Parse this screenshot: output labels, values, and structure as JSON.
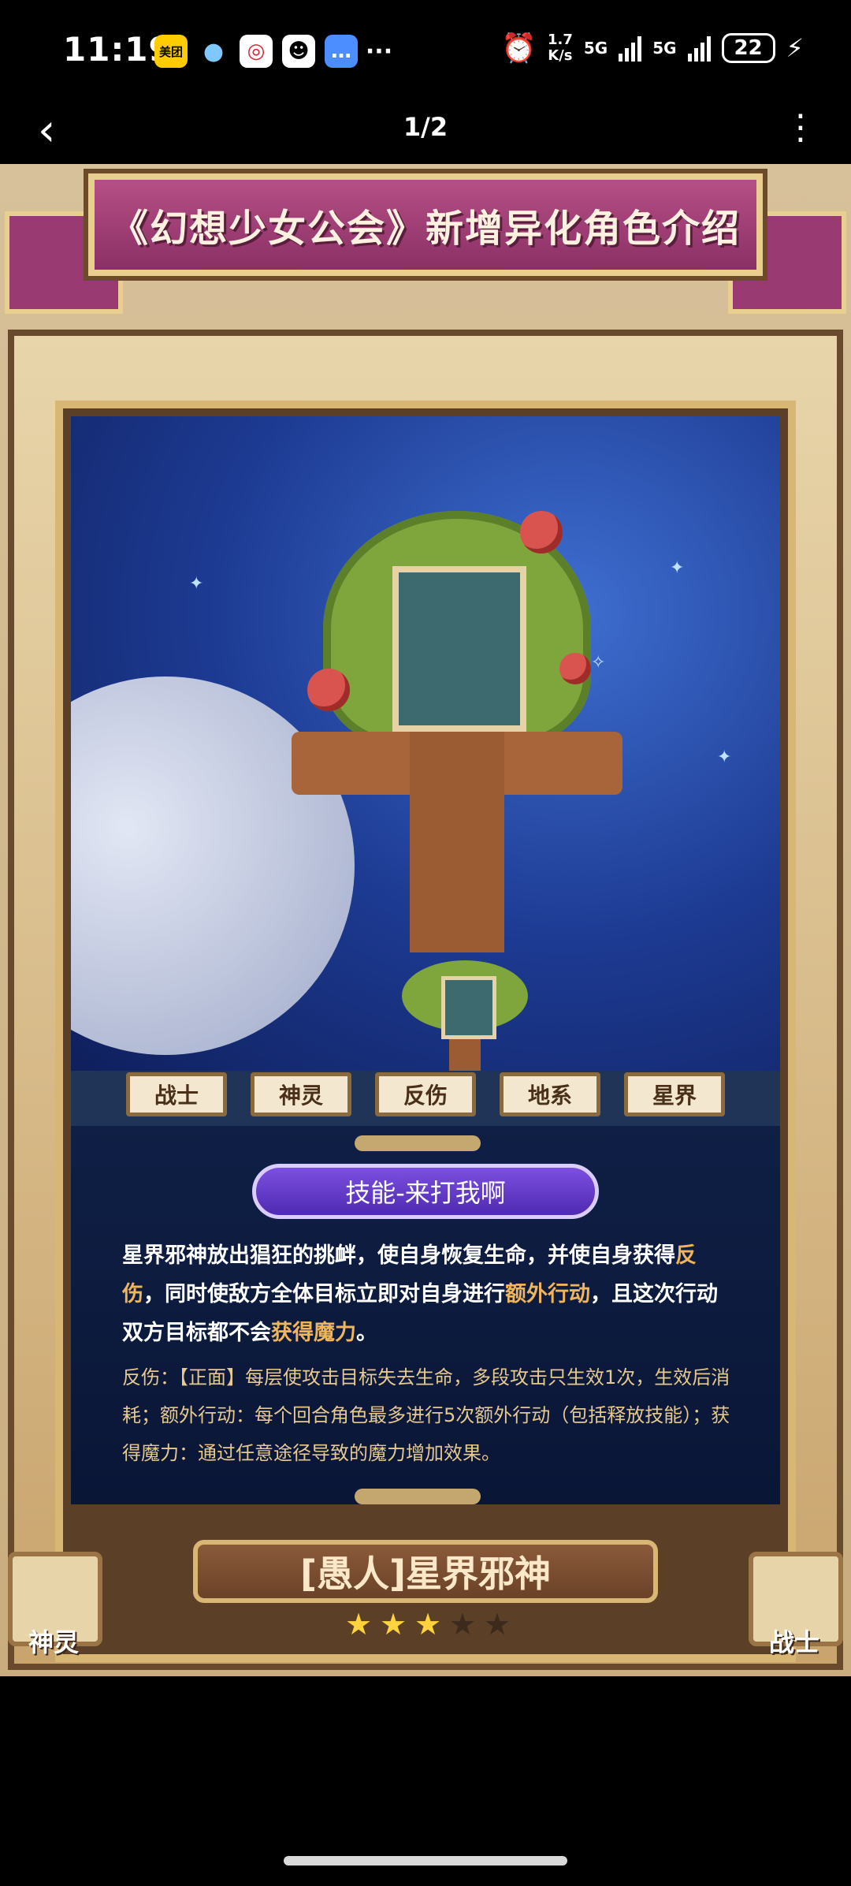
{
  "status_bar": {
    "time": "11:19",
    "app_icons": [
      "美团",
      "chat",
      "mobile",
      "qq",
      "message",
      "more"
    ],
    "meituan_label": "美团",
    "more": "···",
    "net_speed_value": "1.7",
    "net_speed_unit": "K/s",
    "network_1": "5G",
    "network_2": "5G",
    "battery": "22"
  },
  "top_bar": {
    "page_indicator": "1/2",
    "back_icon": "chevron-left",
    "more_icon": "vertical-dots"
  },
  "poster": {
    "title": "《幻想少女公会》新增异化角色介绍",
    "tags": [
      "战士",
      "神灵",
      "反伤",
      "地系",
      "星界"
    ],
    "skill_title": "技能-来打我啊",
    "skill_description_parts": [
      {
        "text": "星界邪神放出猖狂的挑衅，使自身恢复生命，并使自身获得",
        "hl": false
      },
      {
        "text": "反伤",
        "hl": true
      },
      {
        "text": "，同时使敌方全体目标立即对自身进行",
        "hl": false
      },
      {
        "text": "额外行动",
        "hl": true
      },
      {
        "text": "，且这次行动双方目标都不会",
        "hl": false
      },
      {
        "text": "获得魔力",
        "hl": true
      },
      {
        "text": "。",
        "hl": false
      }
    ],
    "notes": "反伤：【正面】每层使攻击目标失去生命，多段攻击只生效1次，生效后消耗；额外行动：每个回合角色最多进行5次额外行动（包括释放技能）；获得魔力：通过任意途径导致的魔力增加效果。",
    "character_name": "[愚人]星界邪神",
    "left_class": "神灵",
    "right_class": "战士",
    "stars_filled": 3,
    "stars_total": 5,
    "colors": {
      "banner": "#9a3a73",
      "highlight": "#f0b45a",
      "skill_pill": "#6a3fd0"
    }
  }
}
